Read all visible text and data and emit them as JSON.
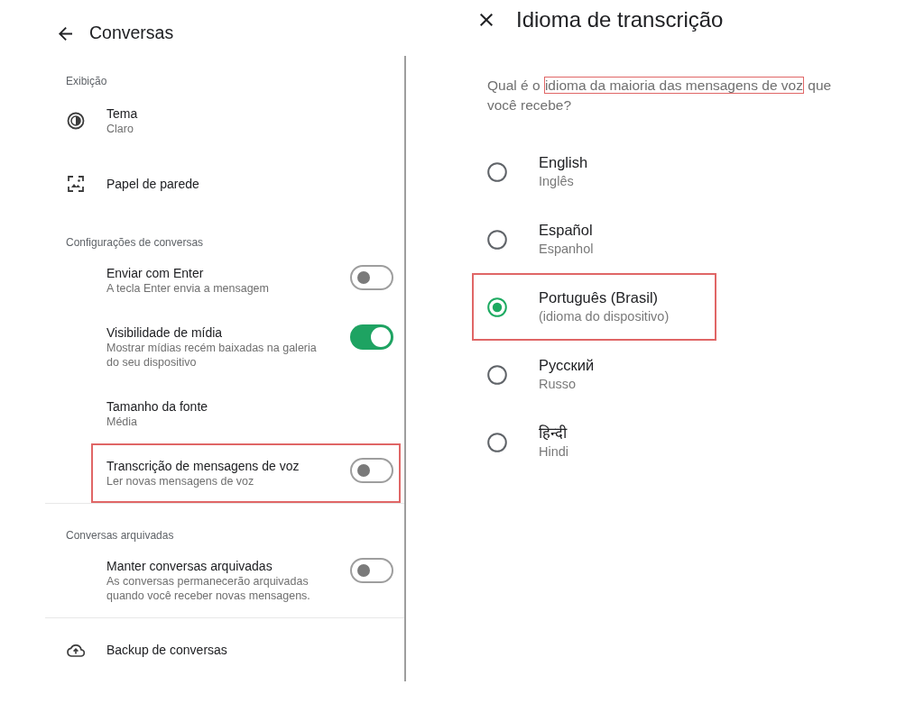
{
  "left_panel": {
    "header": {
      "title": "Conversas"
    },
    "sections": [
      {
        "title": "Exibição",
        "divider_above": false,
        "items": [
          {
            "kind": "theme",
            "title": "Tema",
            "subtitle": "Claro",
            "highlighted": false
          },
          {
            "kind": "wallpaper",
            "title": "Papel de parede",
            "highlighted": false
          }
        ]
      },
      {
        "title": "Configurações de conversas",
        "divider_above": false,
        "items": [
          {
            "kind": "toggle",
            "title": "Enviar com Enter",
            "subtitle": "A tecla Enter envia a mensagem",
            "on": false,
            "highlighted": false
          },
          {
            "kind": "toggle",
            "title": "Visibilidade de mídia",
            "subtitle": "Mostrar mídias recém baixadas na galeria do seu dispositivo",
            "on": true,
            "highlighted": false
          },
          {
            "kind": "plain",
            "title": "Tamanho da fonte",
            "subtitle": "Média",
            "highlighted": false
          },
          {
            "kind": "toggle",
            "title": "Transcrição de mensagens de voz",
            "subtitle": "Ler novas mensagens de voz",
            "on": false,
            "highlighted": true
          }
        ]
      },
      {
        "title": "Conversas arquivadas",
        "divider_above": true,
        "items": [
          {
            "kind": "toggle",
            "title": "Manter conversas arquivadas",
            "subtitle": "As conversas permanecerão arquivadas quando você receber novas mensagens.",
            "on": false,
            "highlighted": false
          }
        ]
      },
      {
        "divider_above": true,
        "items": [
          {
            "kind": "backup",
            "title": "Backup de conversas",
            "highlighted": false
          }
        ]
      }
    ]
  },
  "right_panel": {
    "title": "Idioma de transcrição",
    "question": {
      "before": "Qual é o",
      "highlighted": "idioma da maioria das mensagens de voz",
      "after": "que você recebe?"
    },
    "options": [
      {
        "label": "English",
        "sublabel": "Inglês",
        "selected": false,
        "highlighted": false
      },
      {
        "label": "Español",
        "sublabel": "Espanhol",
        "selected": false,
        "highlighted": false
      },
      {
        "label": "Português (Brasil)",
        "sublabel": "(idioma do dispositivo)",
        "selected": true,
        "highlighted": true
      },
      {
        "label": "Русский",
        "sublabel": "Russo",
        "selected": false,
        "highlighted": false
      },
      {
        "label": "हिन्दी",
        "sublabel": "Hindi",
        "selected": false,
        "highlighted": false
      }
    ]
  }
}
